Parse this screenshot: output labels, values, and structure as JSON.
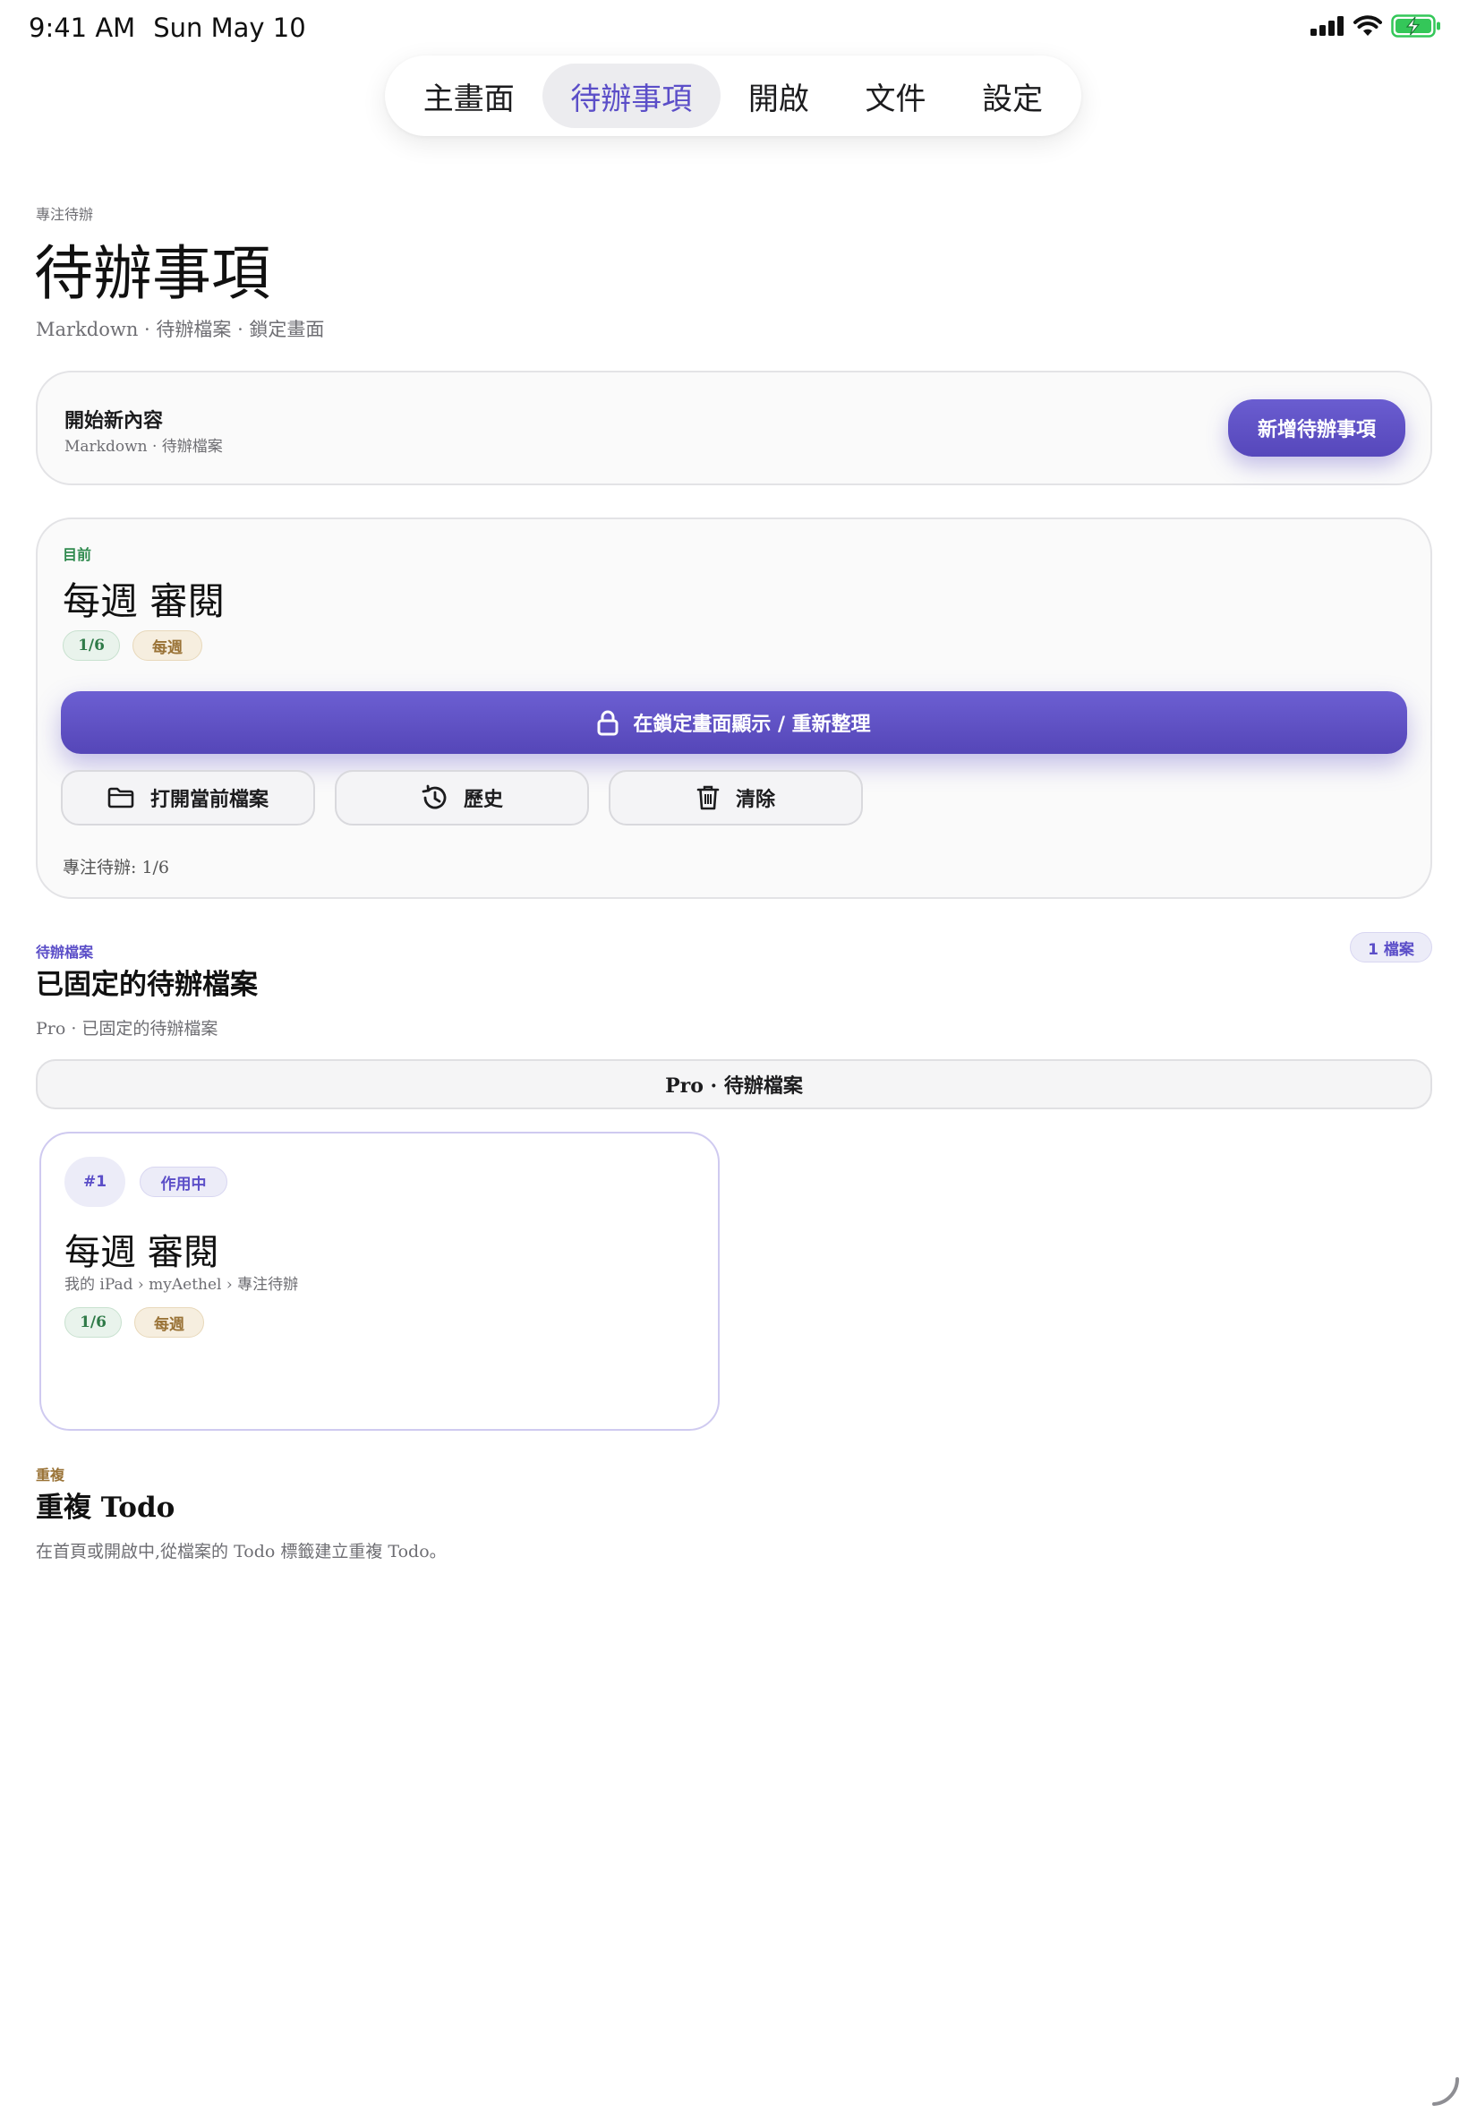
{
  "status_bar": {
    "time": "9:41 AM",
    "date": "Sun May 10"
  },
  "tabs": [
    {
      "label": "主畫面",
      "active": false
    },
    {
      "label": "待辦事項",
      "active": true
    },
    {
      "label": "開啟",
      "active": false
    },
    {
      "label": "文件",
      "active": false
    },
    {
      "label": "設定",
      "active": false
    }
  ],
  "header": {
    "eyebrow": "專注待辦",
    "title": "待辦事項",
    "subtitle": "Markdown · 待辦檔案 · 鎖定畫面"
  },
  "new_content": {
    "heading": "開始新內容",
    "sub": "Markdown · 待辦檔案",
    "button_label": "新增待辦事項"
  },
  "current": {
    "eyebrow": "目前",
    "title": "每週 審閱",
    "progress_chip": "1/6",
    "frequency_chip": "每週",
    "lock_button_label": "在鎖定畫面顯示 / 重新整理",
    "open_file_label": "打開當前檔案",
    "history_label": "歷史",
    "clear_label": "清除",
    "footer": "專注待辦: 1/6"
  },
  "pinned": {
    "eyebrow": "待辦檔案",
    "title": "已固定的待辦檔案",
    "desc": "Pro · 已固定的待辦檔案",
    "count_badge": "1 檔案",
    "pro_bar_label": "Pro · 待辦檔案",
    "file": {
      "index": "#1",
      "state": "作用中",
      "title": "每週 審閱",
      "path": "我的 iPad › myAethel › 專注待辦",
      "progress_chip": "1/6",
      "frequency_chip": "每週"
    }
  },
  "repeat": {
    "eyebrow": "重複",
    "title": "重複 Todo",
    "desc": "在首頁或開啟中,從檔案的 Todo 標籤建立重複 Todo。"
  },
  "colors": {
    "accent": "#5b4ec8",
    "green_eyebrow": "#2f8a4e",
    "tan_eyebrow": "#9a7337",
    "battery": "#34c759"
  }
}
